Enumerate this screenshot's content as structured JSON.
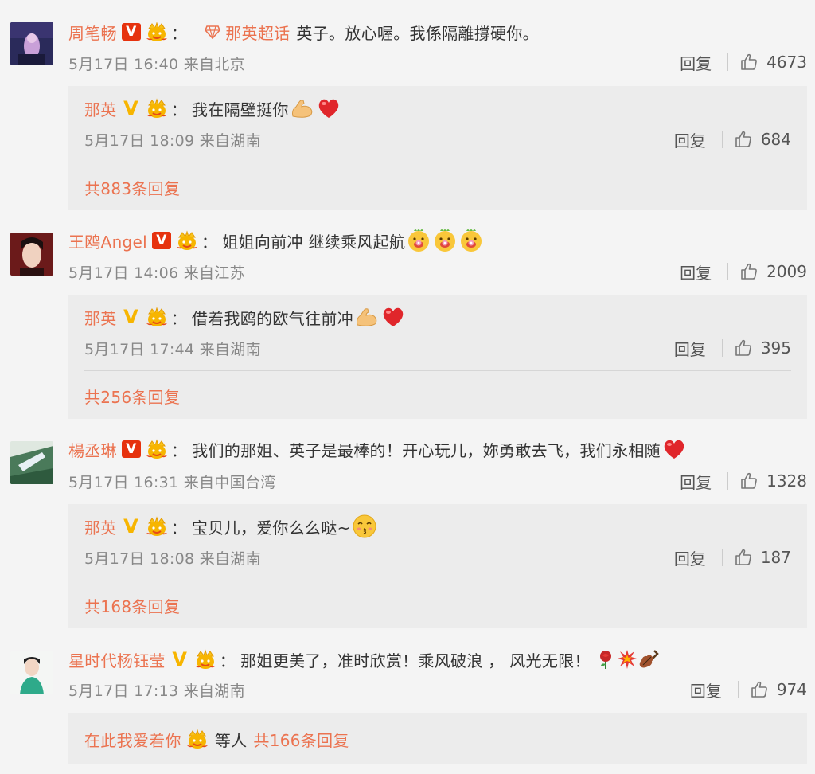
{
  "comments": [
    {
      "username": "周笔畅",
      "verify": "red",
      "topic": "那英超话",
      "text": "英子。放心喔。我係隔離撐硬你。",
      "meta": "5月17日 16:40 来自北京",
      "reply_label": "回复",
      "likes": "4673",
      "reply": {
        "username": "那英",
        "text": "我在隔壁挺你",
        "meta": "5月17日 18:09 来自湖南",
        "reply_label": "回复",
        "likes": "684"
      },
      "more": "共883条回复"
    },
    {
      "username": "王鸥Angel",
      "verify": "red",
      "text": "姐姐向前冲 继续乘风起航",
      "meta": "5月17日 14:06 来自江苏",
      "reply_label": "回复",
      "likes": "2009",
      "reply": {
        "username": "那英",
        "text": "借着我鸥的欧气往前冲",
        "meta": "5月17日 17:44 来自湖南",
        "reply_label": "回复",
        "likes": "395"
      },
      "more": "共256条回复"
    },
    {
      "username": "楊丞琳",
      "verify": "red",
      "text": "我们的那姐、英子是最棒的！开心玩儿，妳勇敢去飞，我们永相随",
      "meta": "5月17日 16:31 来自中国台湾",
      "reply_label": "回复",
      "likes": "1328",
      "reply": {
        "username": "那英",
        "text": "宝贝儿，爱你么么哒~",
        "meta": "5月17日 18:08 来自湖南",
        "reply_label": "回复",
        "likes": "187"
      },
      "more": "共168条回复"
    },
    {
      "username": "星时代杨钰莹",
      "verify": "gold",
      "text": "那姐更美了，准时欣赏！乘风破浪 ， 风光无限！",
      "meta": "5月17日 17:13 来自湖南",
      "reply_label": "回复",
      "likes": "974",
      "summary": {
        "user": "在此我爱着你",
        "mid": "等人",
        "more": "共166条回复"
      }
    }
  ],
  "icons": {
    "thumbs_up": "thumbs-up-icon",
    "heart": "heart-emoji",
    "muscle": "flexed-biceps-emoji",
    "flower_face": "flower-face-emoji",
    "kiss_face": "kissing-face-emoji",
    "rose": "rose-emoji",
    "burst": "collision-emoji",
    "violin": "violin-emoji",
    "fan_badge": "fan-club-badge-icon",
    "topic": "diamond-topic-icon"
  },
  "colors": {
    "accent": "#eb7350",
    "verify_red": "#e6320e",
    "verify_gold": "#f7b500",
    "reply_bg": "#ececec",
    "page_bg": "#f4f4f4"
  }
}
